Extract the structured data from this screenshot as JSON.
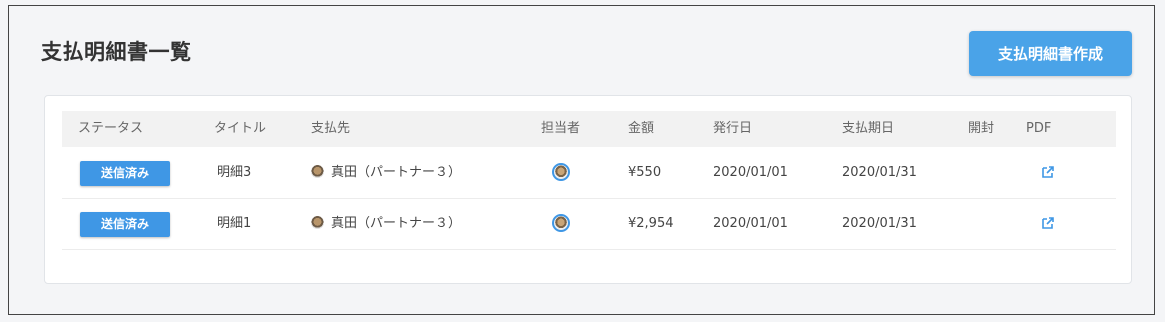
{
  "header": {
    "title": "支払明細書一覧",
    "create_button": "支払明細書作成"
  },
  "table": {
    "columns": [
      "ステータス",
      "タイトル",
      "支払先",
      "担当者",
      "金額",
      "発行日",
      "支払期日",
      "開封",
      "PDF"
    ],
    "rows": [
      {
        "status": "送信済み",
        "title": "明細3",
        "payee": "真田（パートナー３）",
        "amount": "¥550",
        "issue_date": "2020/01/01",
        "due_date": "2020/01/31",
        "opened": ""
      },
      {
        "status": "送信済み",
        "title": "明細1",
        "payee": "真田（パートナー３）",
        "amount": "¥2,954",
        "issue_date": "2020/01/01",
        "due_date": "2020/01/31",
        "opened": ""
      }
    ]
  },
  "colors": {
    "accent": "#4aa3e8",
    "badge": "#3f97e5"
  }
}
